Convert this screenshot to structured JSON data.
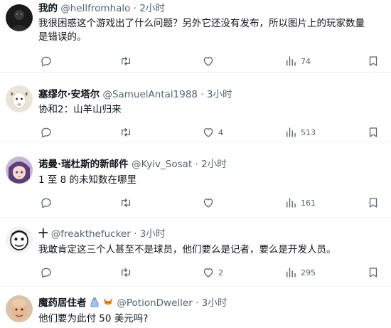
{
  "tweets": [
    {
      "name": "我的",
      "handle": "@hellfromhalo",
      "dot": "·",
      "time": "2小时",
      "text_line1": "我很困惑这个游戏出了什么问题？另外它还没有发布，所以图片上的玩家数量",
      "text_line2": "是错误的。",
      "likes": "",
      "views": "74",
      "avatar": "dark-figure-avatar"
    },
    {
      "name": "塞缪尔·安塔尔",
      "handle": "@SamuelAntal1988",
      "dot": "·",
      "time": "3小时",
      "text_line1": "协和2：山羊山归来",
      "likes": "4",
      "views": "513",
      "avatar": "goat-avatar"
    },
    {
      "name": "诺曼·瑞杜斯的新邮件",
      "handle": "@Kyiv_Sosat",
      "dot": "·",
      "time": "2小时",
      "text_line1": "1 至 8 的未知数在哪里",
      "likes": "",
      "views": "161",
      "avatar": "anime-girl-avatar"
    },
    {
      "name": "十",
      "handle": "@freakthefucker",
      "dot": "·",
      "time": "3小时",
      "text_line1": "我敢肯定这三个人甚至不是球员，他们要么是记者，要么是开发人员。",
      "likes": "2",
      "views": "295",
      "avatar": "cartoon-face-avatar"
    },
    {
      "name": "魔药居住者",
      "handle": "@PotionDweller",
      "dot": "·",
      "time": "3小时",
      "text_line1": "他们要为此付 50 美元吗?",
      "likes": "",
      "views": "",
      "avatar": "bald-man-avatar"
    }
  ],
  "colors": {
    "text": "#0f1419",
    "muted": "#536471",
    "divider": "#eff3f4"
  },
  "icons": [
    "reply-icon",
    "retweet-icon",
    "like-icon",
    "views-icon",
    "bookmark-icon",
    "potion-bottle-emoji",
    "fox-emoji"
  ]
}
